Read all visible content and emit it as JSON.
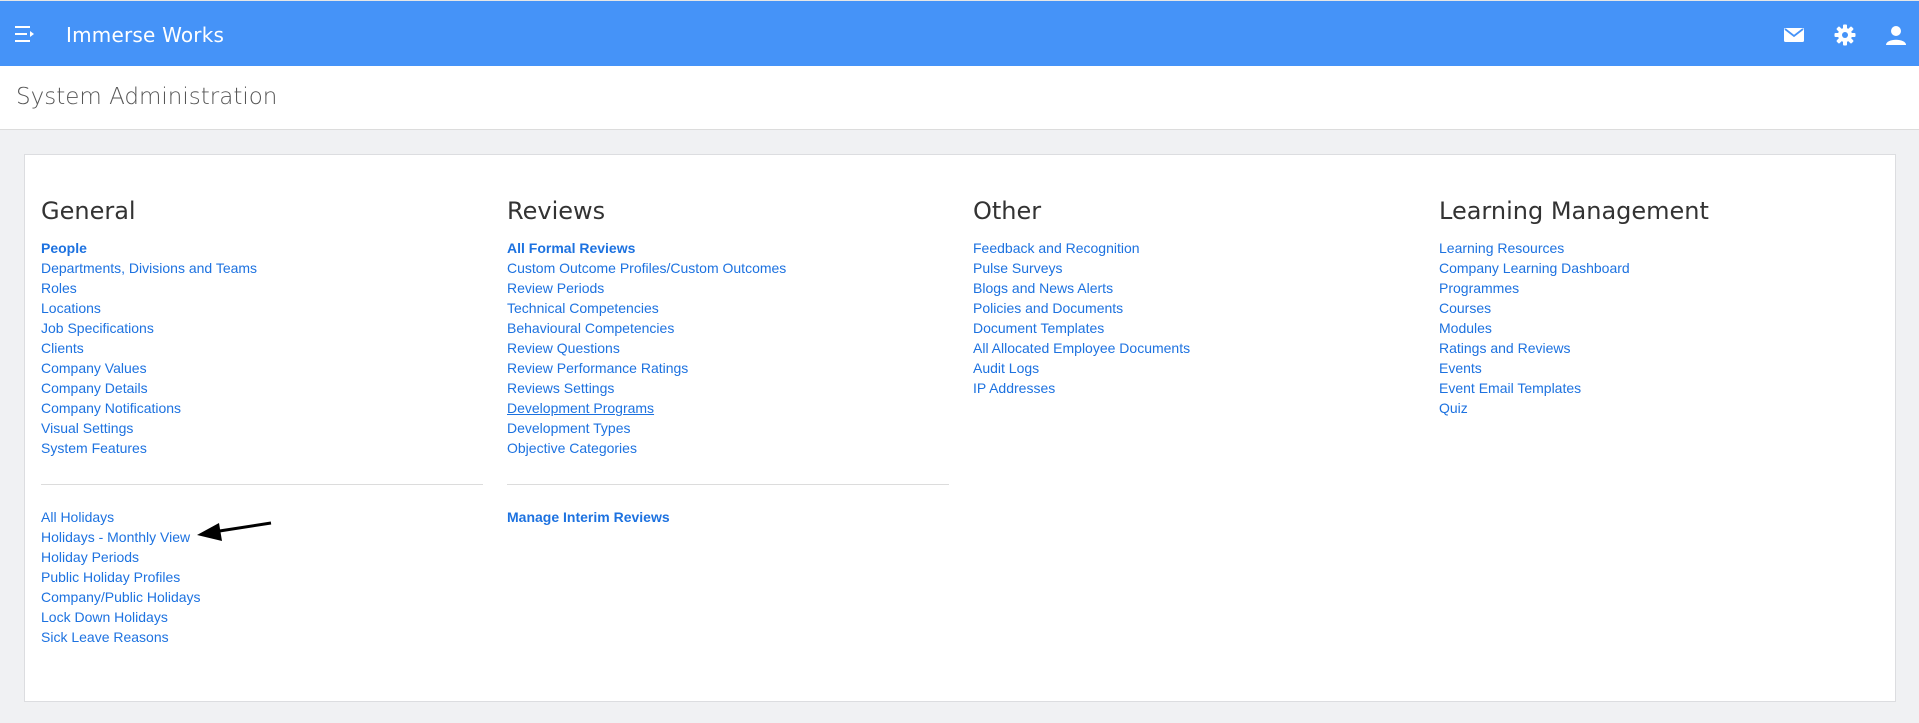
{
  "topbar": {
    "app_title": "Immerse Works"
  },
  "page": {
    "title": "System Administration"
  },
  "columns": [
    {
      "heading": "General",
      "links": [
        {
          "label": "People",
          "bold": true
        },
        {
          "label": "Departments, Divisions and Teams"
        },
        {
          "label": "Roles"
        },
        {
          "label": "Locations"
        },
        {
          "label": "Job Specifications"
        },
        {
          "label": "Clients"
        },
        {
          "label": "Company Values"
        },
        {
          "label": "Company Details"
        },
        {
          "label": "Company Notifications"
        },
        {
          "label": "Visual Settings"
        },
        {
          "label": "System Features"
        }
      ],
      "lower_links": [
        {
          "label": "All Holidays"
        },
        {
          "label": "Holidays - Monthly View"
        },
        {
          "label": "Holiday Periods"
        },
        {
          "label": "Public Holiday Profiles"
        },
        {
          "label": "Company/Public Holidays"
        },
        {
          "label": "Lock Down Holidays"
        },
        {
          "label": "Sick Leave Reasons"
        }
      ]
    },
    {
      "heading": "Reviews",
      "links": [
        {
          "label": "All Formal Reviews",
          "bold": true
        },
        {
          "label": "Custom Outcome Profiles/Custom Outcomes"
        },
        {
          "label": "Review Periods"
        },
        {
          "label": "Technical Competencies"
        },
        {
          "label": "Behavioural Competencies"
        },
        {
          "label": "Review Questions"
        },
        {
          "label": "Review Performance Ratings"
        },
        {
          "label": "Reviews Settings"
        },
        {
          "label": "Development Programs",
          "underline": true
        },
        {
          "label": "Development Types"
        },
        {
          "label": "Objective Categories"
        }
      ],
      "lower_links": [
        {
          "label": "Manage Interim Reviews",
          "bold": true
        }
      ]
    },
    {
      "heading": "Other",
      "links": [
        {
          "label": "Feedback and Recognition"
        },
        {
          "label": "Pulse Surveys"
        },
        {
          "label": "Blogs and News Alerts"
        },
        {
          "label": "Policies and Documents"
        },
        {
          "label": "Document Templates"
        },
        {
          "label": "All Allocated Employee Documents"
        },
        {
          "label": "Audit Logs"
        },
        {
          "label": "IP Addresses"
        }
      ],
      "lower_links": []
    },
    {
      "heading": "Learning Management",
      "links": [
        {
          "label": "Learning Resources"
        },
        {
          "label": "Company Learning Dashboard"
        },
        {
          "label": "Programmes"
        },
        {
          "label": "Courses"
        },
        {
          "label": "Modules"
        },
        {
          "label": "Ratings and Reviews"
        },
        {
          "label": "Events"
        },
        {
          "label": "Event Email Templates"
        },
        {
          "label": "Quiz"
        }
      ],
      "lower_links": []
    }
  ],
  "icons": {
    "menu": "menu-icon",
    "mail": "mail-icon",
    "settings": "gear-icon",
    "user": "user-icon",
    "annotation": "arrow-icon"
  },
  "colors": {
    "accent": "#4593f8",
    "link": "#1d72e0"
  }
}
